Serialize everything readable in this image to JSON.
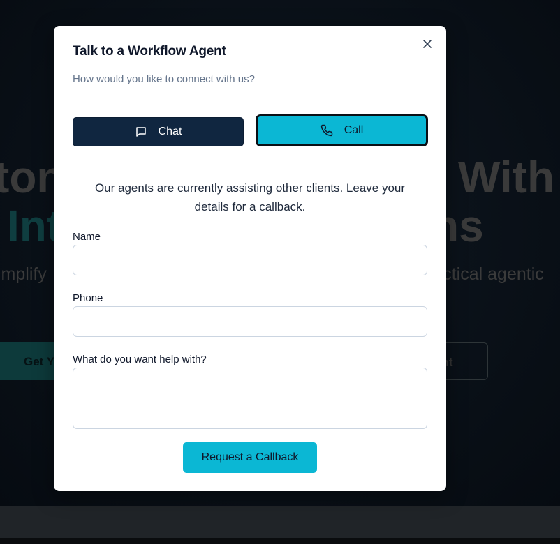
{
  "background": {
    "heading_line1_left": "ton",
    "heading_line1_right": "With",
    "heading_line2_left": "Int",
    "heading_line2_right": "ns",
    "subtitle_left": "implify",
    "subtitle_right": "ractical agentic",
    "cta_left_label": "Get Y",
    "cta_right_label": "ant"
  },
  "modal": {
    "title": "Talk to a Workflow Agent",
    "subtitle": "How would you like to connect with us?",
    "close_icon": "close-icon",
    "modes": {
      "chat_label": "Chat",
      "chat_icon": "message-square-icon",
      "call_label": "Call",
      "call_icon": "phone-icon",
      "selected": "Call"
    },
    "info_text": "Our agents are currently assisting other clients. Leave your details for a callback.",
    "form": {
      "name_label": "Name",
      "name_value": "",
      "phone_label": "Phone",
      "phone_value": "",
      "help_label": "What do you want help with?",
      "help_value": "",
      "submit_label": "Request a Callback"
    }
  },
  "colors": {
    "accent": "#0bb7d4",
    "navy": "#102640",
    "overlay": "#050a10"
  }
}
